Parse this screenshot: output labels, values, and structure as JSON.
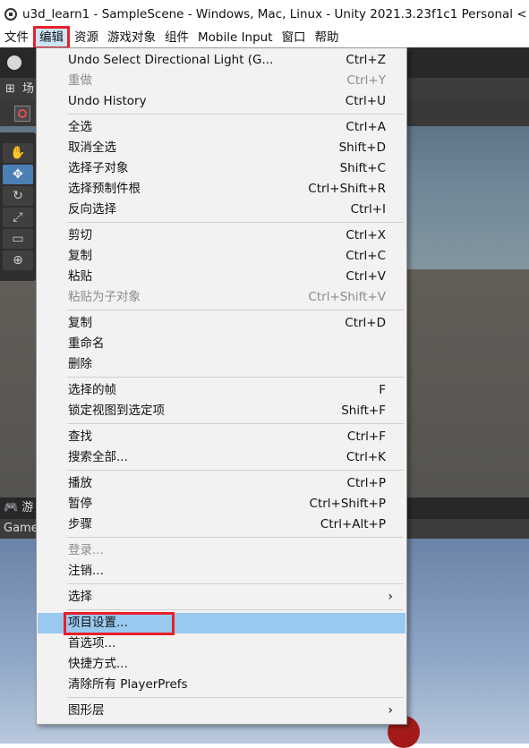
{
  "window": {
    "title": "u3d_learn1 - SampleScene - Windows, Mac, Linux - Unity 2021.3.23f1c1 Personal <"
  },
  "menubar": {
    "items": [
      "文件",
      "编辑",
      "资源",
      "游戏对象",
      "组件",
      "Mobile Input",
      "窗口",
      "帮助"
    ],
    "active": "编辑"
  },
  "scene": {
    "tab_icon": "⊞",
    "tab_label": "场",
    "account_icon": "user-circle-icon"
  },
  "game": {
    "tab_label": "游",
    "sub_label": "Game"
  },
  "edit_menu": {
    "items": [
      {
        "label": "Undo Select Directional Light (G...",
        "shortcut": "Ctrl+Z"
      },
      {
        "label": "重做",
        "shortcut": "Ctrl+Y",
        "disabled": true
      },
      {
        "label": "Undo History",
        "shortcut": "Ctrl+U"
      },
      {
        "label": "全选",
        "shortcut": "Ctrl+A"
      },
      {
        "label": "取消全选",
        "shortcut": "Shift+D"
      },
      {
        "label": "选择子对象",
        "shortcut": "Shift+C"
      },
      {
        "label": "选择预制件根",
        "shortcut": "Ctrl+Shift+R"
      },
      {
        "label": "反向选择",
        "shortcut": "Ctrl+I"
      },
      {
        "label": "剪切",
        "shortcut": "Ctrl+X"
      },
      {
        "label": "复制",
        "shortcut": "Ctrl+C"
      },
      {
        "label": "粘贴",
        "shortcut": "Ctrl+V"
      },
      {
        "label": "粘贴为子对象",
        "shortcut": "Ctrl+Shift+V",
        "disabled": true
      },
      {
        "label": "复制",
        "shortcut": "Ctrl+D"
      },
      {
        "label": "重命名",
        "shortcut": ""
      },
      {
        "label": "删除",
        "shortcut": ""
      },
      {
        "label": "选择的帧",
        "shortcut": "F"
      },
      {
        "label": "锁定视图到选定项",
        "shortcut": "Shift+F"
      },
      {
        "label": "查找",
        "shortcut": "Ctrl+F"
      },
      {
        "label": "搜索全部...",
        "shortcut": "Ctrl+K"
      },
      {
        "label": "播放",
        "shortcut": "Ctrl+P"
      },
      {
        "label": "暂停",
        "shortcut": "Ctrl+Shift+P"
      },
      {
        "label": "步骤",
        "shortcut": "Ctrl+Alt+P"
      },
      {
        "label": "登录...",
        "shortcut": "",
        "disabled": true
      },
      {
        "label": "注销...",
        "shortcut": ""
      },
      {
        "label": "选择",
        "shortcut": "",
        "submenu": true
      },
      {
        "label": "项目设置...",
        "shortcut": "",
        "highlighted": true
      },
      {
        "label": "首选项...",
        "shortcut": ""
      },
      {
        "label": "快捷方式...",
        "shortcut": ""
      },
      {
        "label": "清除所有 PlayerPrefs",
        "shortcut": ""
      },
      {
        "label": "图形层",
        "shortcut": "",
        "submenu": true
      }
    ],
    "submenu_arrow": "›"
  },
  "toolstrip": {
    "tools": [
      "hand-tool-icon",
      "move-tool-icon",
      "rotate-tool-icon",
      "scale-tool-icon",
      "rect-tool-icon",
      "transform-tool-icon"
    ],
    "glyphs": [
      "✋",
      "✥",
      "↻",
      "⤢",
      "▭",
      "⊕"
    ]
  },
  "colors": {
    "highlight": "#99c9ef",
    "annotation_red": "#e8202a",
    "menu_bg": "#f2f2f2"
  }
}
